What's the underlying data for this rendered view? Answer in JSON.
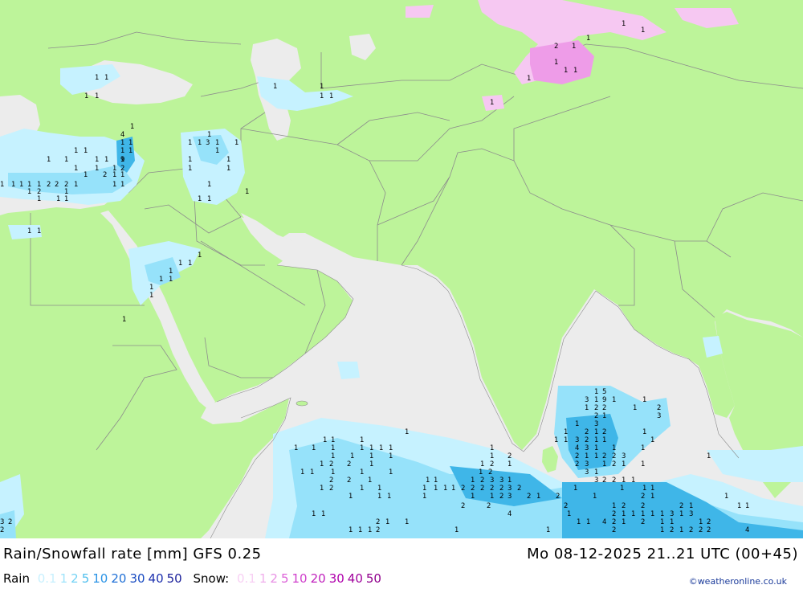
{
  "map": {
    "colors": {
      "land": "#bdf49a",
      "sea": "#ececec",
      "border": "#8c8c8c",
      "rain_light": "#c6f2ff",
      "rain_mid": "#96e2fa",
      "rain_heavy": "#3fb6e8",
      "snow_light": "#f6c8f2",
      "snow_mid": "#ee9ce8"
    },
    "labels": [
      "1",
      "2",
      "3",
      "4",
      "5",
      "9"
    ]
  },
  "footer": {
    "title": "Rain/Snowfall rate [mm] GFS 0.25",
    "datetime": "Mo 08-12-2025 21..21 UTC (00+45)",
    "rain_label": "Rain",
    "snow_label": "Snow:",
    "rain_scale": [
      {
        "v": "0.1",
        "c": "#c8f0fe"
      },
      {
        "v": "1",
        "c": "#a0e4fb"
      },
      {
        "v": "2",
        "c": "#73d2f5"
      },
      {
        "v": "5",
        "c": "#4fbfee"
      },
      {
        "v": "10",
        "c": "#2a93e6"
      },
      {
        "v": "20",
        "c": "#1f6fd6"
      },
      {
        "v": "30",
        "c": "#1a4cc2"
      },
      {
        "v": "40",
        "c": "#1b2fae"
      },
      {
        "v": "50",
        "c": "#1a1f9a"
      }
    ],
    "snow_scale": [
      {
        "v": "0.1",
        "c": "#f8d0f4"
      },
      {
        "v": "1",
        "c": "#f0b0ec"
      },
      {
        "v": "2",
        "c": "#e890e4"
      },
      {
        "v": "5",
        "c": "#dc60d8"
      },
      {
        "v": "10",
        "c": "#d040cc"
      },
      {
        "v": "20",
        "c": "#c020bc"
      },
      {
        "v": "30",
        "c": "#b000ac"
      },
      {
        "v": "40",
        "c": "#a0009c"
      },
      {
        "v": "50",
        "c": "#90008c"
      }
    ],
    "credit": "©weatheronline.co.uk"
  }
}
